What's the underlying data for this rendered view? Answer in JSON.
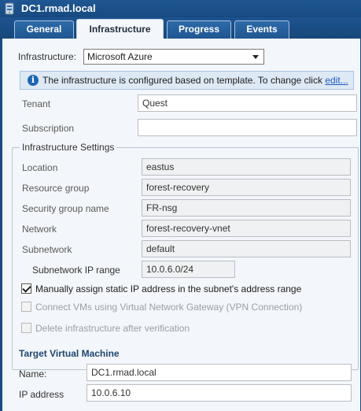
{
  "window": {
    "title": "DC1.rmad.local",
    "icon": "server-icon"
  },
  "tabs": [
    {
      "label": "General",
      "active": false
    },
    {
      "label": "Infrastructure",
      "active": true
    },
    {
      "label": "Progress",
      "active": false
    },
    {
      "label": "Events",
      "active": false
    }
  ],
  "infrastructure": {
    "label": "Infrastructure:",
    "selected": "Microsoft Azure"
  },
  "infobar": {
    "icon": "info-icon",
    "message": "The infrastructure is configured based on template. To change click ",
    "link": "edit..."
  },
  "tenant": {
    "label": "Tenant",
    "value": "Quest"
  },
  "subscription": {
    "label": "Subscription",
    "value": ""
  },
  "settings": {
    "legend": "Infrastructure Settings",
    "location": {
      "label": "Location",
      "value": "eastus"
    },
    "resource_group": {
      "label": "Resource group",
      "value": "forest-recovery"
    },
    "security_group": {
      "label": "Security group name",
      "value": "FR-nsg"
    },
    "network": {
      "label": "Network",
      "value": "forest-recovery-vnet"
    },
    "subnetwork": {
      "label": "Subnetwork",
      "value": "default"
    },
    "subnet_range": {
      "label": "Subnetwork IP range",
      "value": "10.0.6.0/24"
    },
    "manual_ip": {
      "label": "Manually assign static IP address in the subnet's address range",
      "checked": true
    },
    "vpn": {
      "label": "Connect VMs using Virtual Network Gateway (VPN Connection)",
      "checked": false,
      "disabled": true
    },
    "delete_infra": {
      "label": "Delete infrastructure after verification",
      "checked": false,
      "disabled": true
    }
  },
  "target_vm": {
    "title": "Target Virtual Machine",
    "name": {
      "label": "Name:",
      "value": "DC1.rmad.local"
    },
    "ip": {
      "label": "IP address",
      "value": "10.0.6.10"
    }
  }
}
